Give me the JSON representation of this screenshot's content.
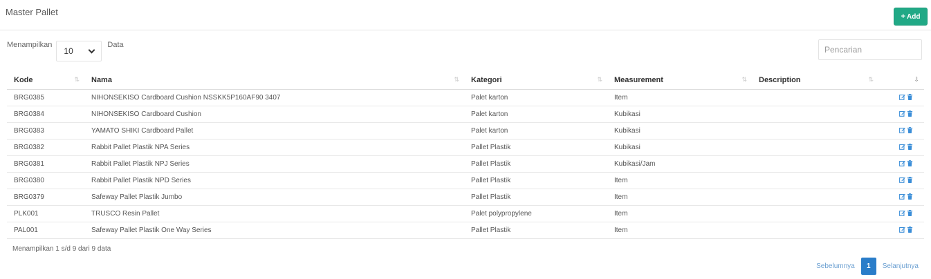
{
  "header": {
    "title": "Master Pallet",
    "add_label": "Add"
  },
  "length": {
    "prefix": "Menampilkan",
    "selected": "10",
    "suffix": "Data"
  },
  "search": {
    "placeholder": "Pencarian"
  },
  "table": {
    "columns": [
      "Kode",
      "Nama",
      "Kategori",
      "Measurement",
      "Description"
    ],
    "rows": [
      {
        "kode": "BRG0385",
        "nama": "NIHONSEKISO Cardboard Cushion NSSKK5P160AF90 3407",
        "kategori": "Palet karton",
        "measurement": "Item",
        "description": ""
      },
      {
        "kode": "BRG0384",
        "nama": "NIHONSEKISO Cardboard Cushion",
        "kategori": "Palet karton",
        "measurement": "Kubikasi",
        "description": ""
      },
      {
        "kode": "BRG0383",
        "nama": "YAMATO SHIKI Cardboard Pallet",
        "kategori": "Palet karton",
        "measurement": "Kubikasi",
        "description": ""
      },
      {
        "kode": "BRG0382",
        "nama": "Rabbit Pallet Plastik NPA Series",
        "kategori": "Pallet Plastik",
        "measurement": "Kubikasi",
        "description": ""
      },
      {
        "kode": "BRG0381",
        "nama": "Rabbit Pallet Plastik NPJ Series",
        "kategori": "Pallet Plastik",
        "measurement": "Kubikasi/Jam",
        "description": ""
      },
      {
        "kode": "BRG0380",
        "nama": "Rabbit Pallet Plastik NPD Series",
        "kategori": "Pallet Plastik",
        "measurement": "Item",
        "description": ""
      },
      {
        "kode": "BRG0379",
        "nama": "Safeway Pallet Plastik Jumbo",
        "kategori": "Pallet Plastik",
        "measurement": "Item",
        "description": ""
      },
      {
        "kode": "PLK001",
        "nama": "TRUSCO Resin Pallet",
        "kategori": "Palet polypropylene",
        "measurement": "Item",
        "description": ""
      },
      {
        "kode": "PAL001",
        "nama": "Safeway Pallet Plastik One Way Series",
        "kategori": "Pallet Plastik",
        "measurement": "Item",
        "description": ""
      }
    ]
  },
  "footer": {
    "info": "Menampilkan 1 s/d 9 dari 9 data"
  },
  "pagination": {
    "prev": "Sebelumnya",
    "current": "1",
    "next": "Selanjutnya"
  },
  "colors": {
    "accent": "#21a986",
    "page_active": "#2a7dc9",
    "icon": "#3b8ed8"
  },
  "icons": {
    "add": "plus-icon",
    "row_edit": "edit-icon",
    "row_delete": "trash-icon",
    "sort": "sort-icon"
  }
}
